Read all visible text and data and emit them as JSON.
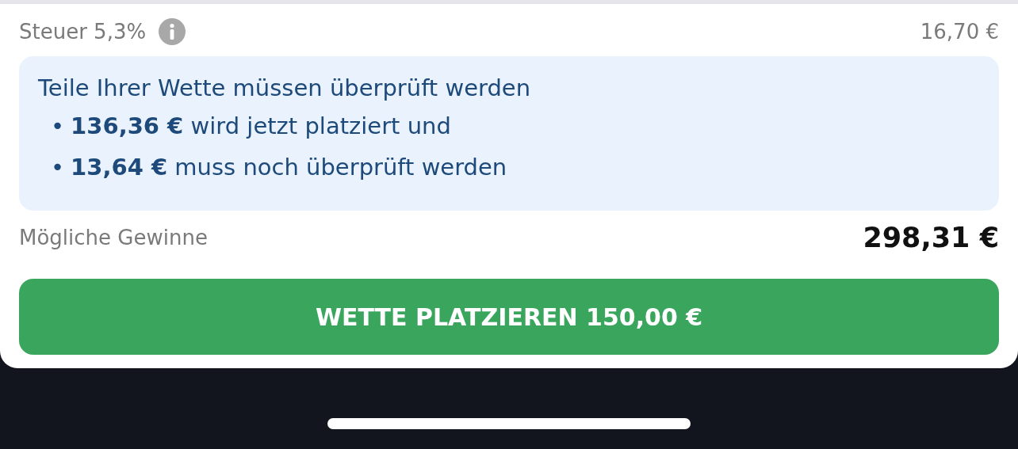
{
  "tax": {
    "label": "Steuer 5,3%",
    "amount": "16,70 €"
  },
  "notice": {
    "title": "Teile Ihrer Wette müssen überprüft werden",
    "items": [
      {
        "bullet": "•",
        "text": "**136,36 €** wird jetzt platziert und"
      },
      {
        "bullet": "•",
        "text": "**13,64 €** muss noch überprüft werden"
      }
    ]
  },
  "winnings": {
    "label": "Mögliche Gewinne",
    "amount": "298,31 €"
  },
  "place_button": {
    "label": "WETTE PLATZIEREN 150,00 €"
  }
}
